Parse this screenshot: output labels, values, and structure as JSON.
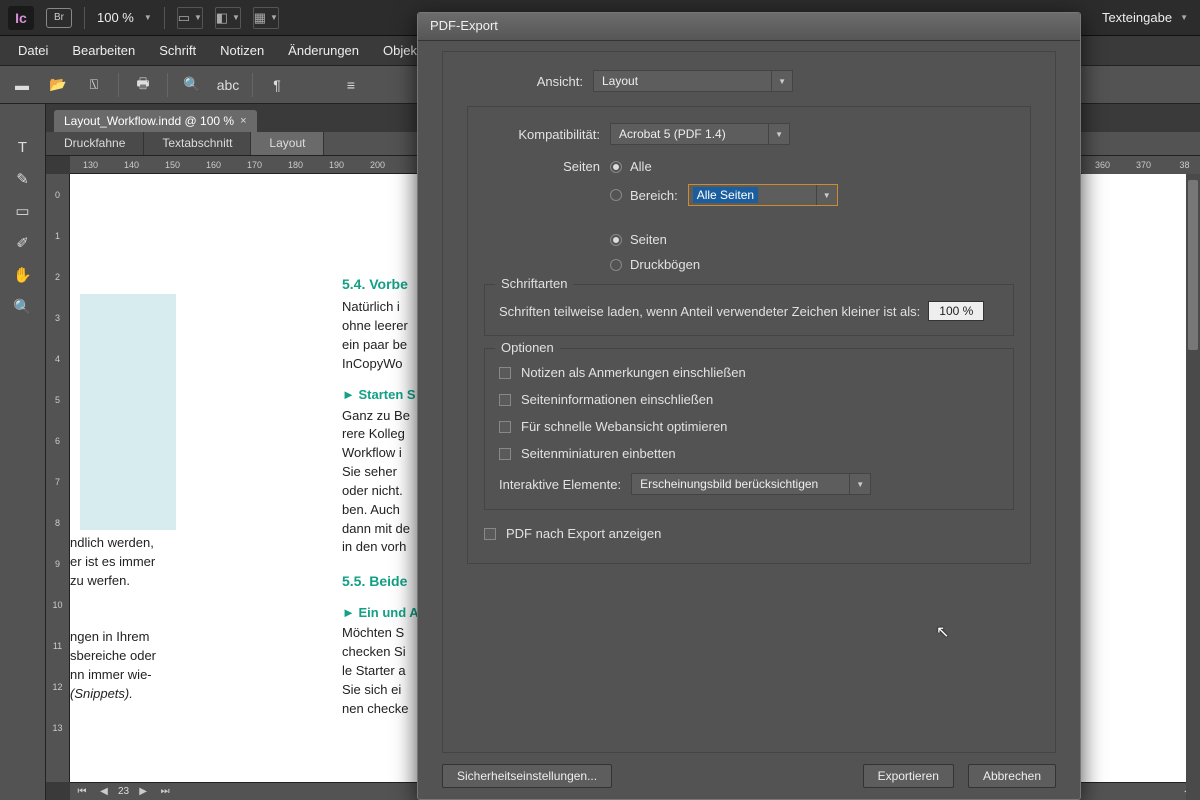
{
  "app": {
    "logo": "Ic",
    "bridge": "Br"
  },
  "topbar": {
    "zoom": "100 %",
    "mode_label": "Texteingabe"
  },
  "menus": [
    "Datei",
    "Bearbeiten",
    "Schrift",
    "Notizen",
    "Änderungen",
    "Objek"
  ],
  "doc_tab": {
    "title": "Layout_Workflow.indd @ 100 %"
  },
  "view_tabs": [
    "Druckfahne",
    "Textabschnitt",
    "Layout"
  ],
  "h_ruler": [
    "130",
    "140",
    "150",
    "160",
    "170",
    "180",
    "190",
    "200"
  ],
  "h_ruler_right": [
    "360",
    "370",
    "38"
  ],
  "v_ruler": [
    "0",
    "1",
    "2",
    "3",
    "4",
    "5",
    "6",
    "7",
    "8",
    "9",
    "10",
    "11",
    "12",
    "13"
  ],
  "status": {
    "page": "23"
  },
  "page_text": {
    "left_lines": "ndlich werden,\ner ist es immer\nzu werfen.",
    "left_block2": "ngen in Ihrem\nsbereiche oder\nnn immer wie-",
    "left_em": "(Snippets).",
    "h54": "5.4.  Vorbe",
    "p1": "Natürlich i\nohne leerer\nein paar be\nInCopyWo",
    "hb1": "►  Starten S",
    "p2": "Ganz zu Be\nrere Kolleg\nWorkflow i\n  Sie seher\noder nicht.\nben. Auch\ndann mit de\nin den vorh",
    "h55": "5.5.  Beide",
    "hb2": "►  Ein und A",
    "p3": "Möchten S\nchecken Si\nle Starter a\nSie sich ei\nnen  checke"
  },
  "dialog": {
    "title": "PDF-Export",
    "view_label": "Ansicht:",
    "view_value": "Layout",
    "compat_label": "Kompatibilität:",
    "compat_value": "Acrobat 5 (PDF 1.4)",
    "pages_label": "Seiten",
    "pages_all": "Alle",
    "range_label": "Bereich:",
    "range_value": "Alle Seiten",
    "pages_opt": "Seiten",
    "spreads_opt": "Druckbögen",
    "fonts_legend": "Schriftarten",
    "fonts_text": "Schriften teilweise laden, wenn Anteil verwendeter Zeichen kleiner ist als:",
    "fonts_pct": "100 %",
    "options_legend": "Optionen",
    "opt_notes": "Notizen als Anmerkungen einschließen",
    "opt_pageinfo": "Seiteninformationen einschließen",
    "opt_fastweb": "Für schnelle Webansicht optimieren",
    "opt_thumbs": "Seitenminiaturen einbetten",
    "interactive_label": "Interaktive Elemente:",
    "interactive_value": "Erscheinungsbild berücksichtigen",
    "view_after": "PDF nach Export anzeigen",
    "security_btn": "Sicherheitseinstellungen...",
    "export_btn": "Exportieren",
    "cancel_btn": "Abbrechen"
  }
}
